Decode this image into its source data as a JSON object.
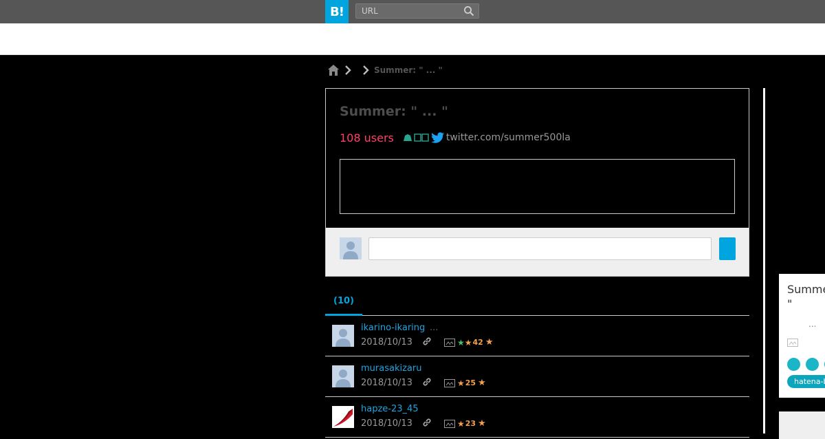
{
  "header": {
    "logo_text": "B!",
    "search_placeholder": "URL"
  },
  "breadcrumb": {
    "title": "Summer: \" ... \""
  },
  "entry": {
    "title": "Summer: \" ... \"",
    "users": "108 users",
    "domain": "twitter.com/summer500la"
  },
  "tabs": {
    "active_label": "(10)"
  },
  "bookmarks": [
    {
      "user": "ikarino-ikaring",
      "comment": "...",
      "date": "2018/10/13",
      "star_count": "42",
      "avatar": "default",
      "stars": [
        "green",
        "orange"
      ]
    },
    {
      "user": "murasakizaru",
      "comment": "",
      "date": "2018/10/13",
      "star_count": "25",
      "avatar": "default",
      "stars": [
        "orange"
      ]
    },
    {
      "user": "hapze-23_45",
      "comment": "",
      "date": "2018/10/13",
      "star_count": "23",
      "avatar": "red",
      "stars": [
        "orange"
      ]
    }
  ],
  "sidebar": {
    "title": "Summer: \"",
    "ellipsis": "...",
    "tag": "hatena-b"
  },
  "colors": {
    "accent": "#00a4de",
    "users": "#ff4166",
    "star_orange": "#f4a04a",
    "star_green": "#4dc06a",
    "teal": "#1bb5c8"
  }
}
